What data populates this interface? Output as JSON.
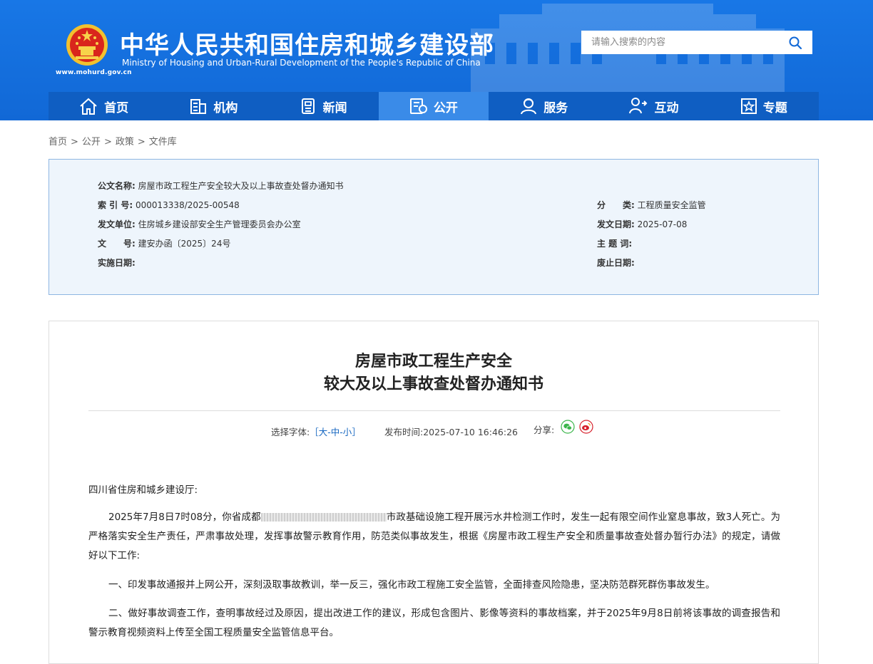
{
  "header": {
    "title_cn": "中华人民共和国住房和城乡建设部",
    "title_en": "Ministry of Housing and Urban-Rural Development of the People's Republic of China",
    "site_url": "www.mohurd.gov.cn",
    "search_placeholder": "请输入搜索的内容",
    "colors": {
      "brand_blue": "#1168d6",
      "nav_blue": "#0f5ec2",
      "nav_active": "#3a8be8"
    }
  },
  "nav": {
    "items": [
      {
        "label": "首页",
        "icon": "home-icon"
      },
      {
        "label": "机构",
        "icon": "building-icon"
      },
      {
        "label": "新闻",
        "icon": "news-icon"
      },
      {
        "label": "公开",
        "icon": "document-icon",
        "active": true
      },
      {
        "label": "服务",
        "icon": "service-icon"
      },
      {
        "label": "互动",
        "icon": "interaction-icon"
      },
      {
        "label": "专题",
        "icon": "star-icon"
      }
    ]
  },
  "breadcrumb": [
    "首页",
    "公开",
    "政策",
    "文件库"
  ],
  "info": {
    "doc_name_label": "公文名称:",
    "doc_name": "房屋市政工程生产安全较大及以上事故查处督办通知书",
    "index_label": "索 引 号:",
    "index": "000013338/2025-00548",
    "category_label": "分　　类:",
    "category": "工程质量安全监管",
    "issuer_label": "发文单位:",
    "issuer": "住房城乡建设部安全生产管理委员会办公室",
    "issue_date_label": "发文日期:",
    "issue_date": "2025-07-08",
    "doc_no_label": "文　　号:",
    "doc_no": "建安办函〔2025〕24号",
    "keywords_label": "主 题 词:",
    "keywords": "",
    "effective_label": "实施日期:",
    "effective": "",
    "expiry_label": "废止日期:",
    "expiry": ""
  },
  "article": {
    "title_line1": "房屋市政工程生产安全",
    "title_line2": "较大及以上事故查处督办通知书",
    "font_label": "选择字体:",
    "font_open": "［",
    "font_large": "大",
    "font_medium": "中",
    "font_small": "小",
    "font_dash": "-",
    "font_close": "］",
    "publish_label": "发布时间:",
    "publish_time": "2025-07-10 16:46:26",
    "share_label": "分享:",
    "salutation": "四川省住房和城乡建设厅:",
    "para1_a": "2025年7月8日7时08分，你省成都",
    "para1_b": "市政基础设施工程开展污水井检测工作时，发生一起有限空间作业窒息事故，致3人死亡。为严格落实安全生产责任，严肃事故处理，发挥事故警示教育作用，防范类似事故发生，根据《房屋市政工程生产安全和质量事故查处督办暂行办法》的规定，请做好以下工作:",
    "para2": "一、印发事故通报并上网公开，深刻汲取事故教训，举一反三，强化市政工程施工安全监管，全面排查风险隐患，坚决防范群死群伤事故发生。",
    "para3": "二、做好事故调查工作，查明事故经过及原因，提出改进工作的建议，形成包含图片、影像等资料的事故档案，并于2025年9月8日前将该事故的调查报告和警示教育视频资料上传至全国工程质量安全监管信息平台。"
  }
}
